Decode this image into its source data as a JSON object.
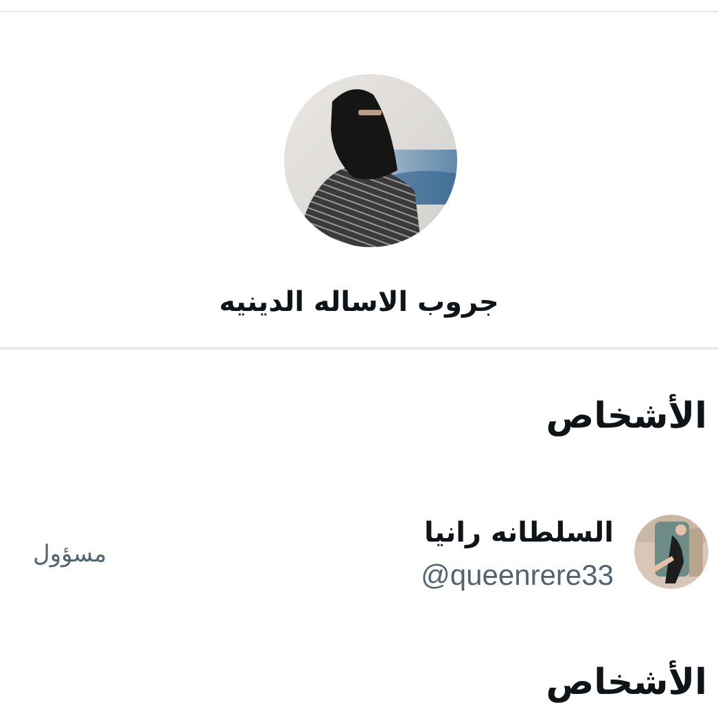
{
  "group": {
    "name": "جروب  الاساله الدينيه",
    "avatar_icon": "group-photo-woman-in-niqab"
  },
  "people_section": {
    "title": "الأشخاص"
  },
  "members": [
    {
      "name": "السلطانه رانيا",
      "handle": "@queenrere33",
      "role": "مسؤول",
      "avatar_icon": "user-photo"
    }
  ],
  "next_section": {
    "title": "الأشخاص"
  }
}
